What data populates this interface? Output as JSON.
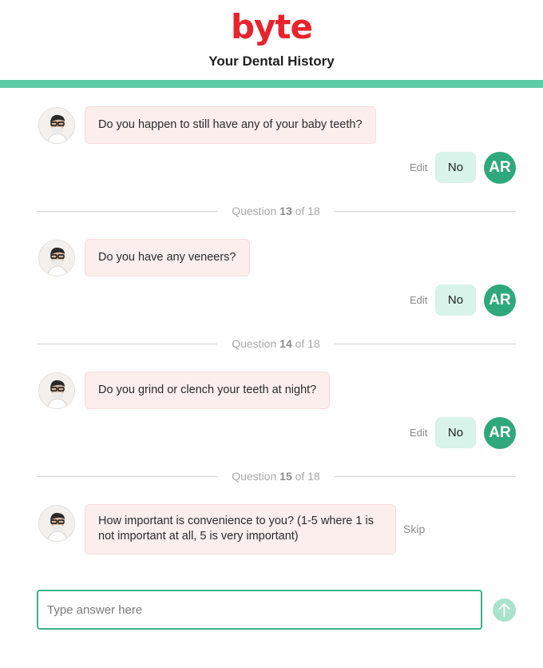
{
  "header": {
    "logo_text": "byte",
    "title": "Your Dental History",
    "brand_color": "#e8232c",
    "accent_color": "#5fcba7"
  },
  "conversation": [
    {
      "question": "Do you happen to still have any of your baby teeth?",
      "answer": "No",
      "edit_label": "Edit",
      "user_initials": "AR"
    },
    {
      "divider": {
        "prefix": "Question",
        "number": "13",
        "suffix": "of 18"
      },
      "question": "Do you have any veneers?",
      "answer": "No",
      "edit_label": "Edit",
      "user_initials": "AR"
    },
    {
      "divider": {
        "prefix": "Question",
        "number": "14",
        "suffix": "of 18"
      },
      "question": "Do you grind or clench your teeth at night?",
      "answer": "No",
      "edit_label": "Edit",
      "user_initials": "AR"
    },
    {
      "divider": {
        "prefix": "Question",
        "number": "15",
        "suffix": "of 18"
      },
      "question_line1": "How important is convenience to you? (1-5 where 1 is",
      "question_line2": "not important at all, 5 is very important)",
      "skip_label": "Skip"
    }
  ],
  "composer": {
    "placeholder": "Type answer here",
    "value": "",
    "send_icon": "arrow-up-icon"
  },
  "colors": {
    "bubble_bg": "#fdeeee",
    "answer_pill_bg": "#d7f3ea",
    "user_avatar_bg": "#2ea87c",
    "input_border": "#36b388",
    "send_button_bg": "#a9e2cd"
  }
}
